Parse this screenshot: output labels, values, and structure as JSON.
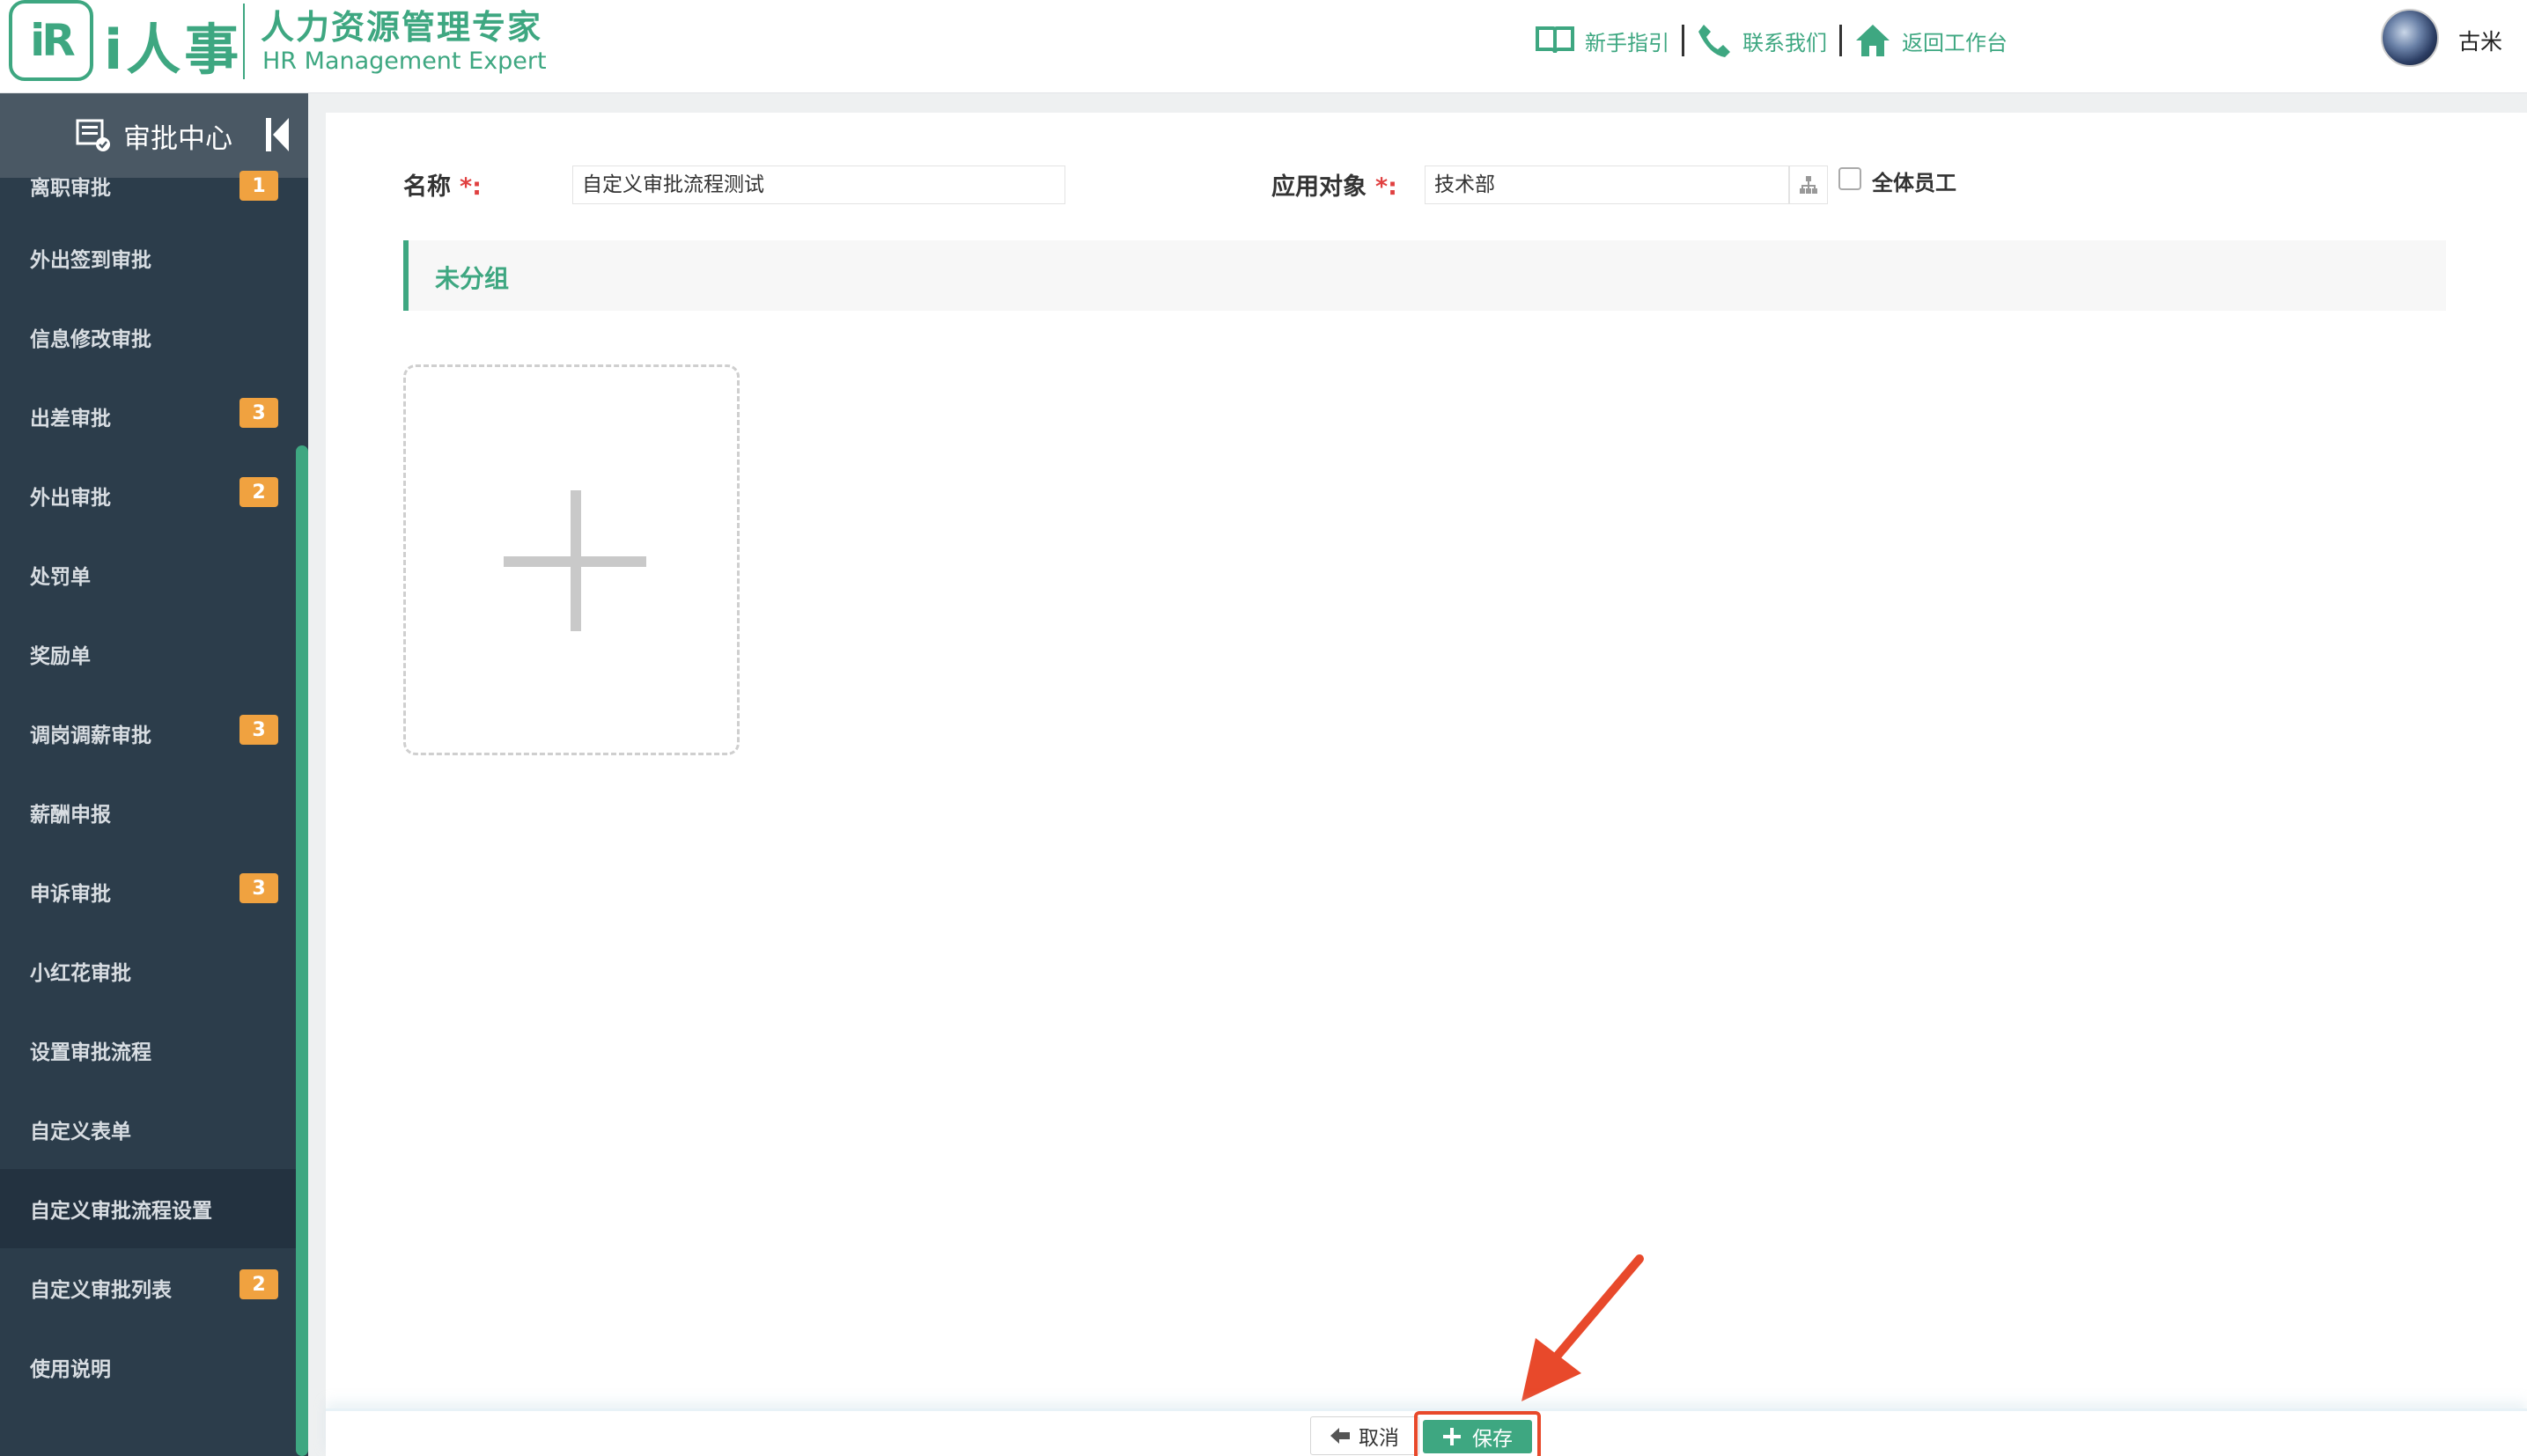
{
  "header": {
    "logo_mark": "iR",
    "logo_name": "i人事",
    "logo_cn": "人力资源管理专家",
    "logo_en": "HR Management Expert",
    "links": [
      {
        "label": "新手指引",
        "icon": "book-icon"
      },
      {
        "label": "联系我们",
        "icon": "phone-icon"
      },
      {
        "label": "返回工作台",
        "icon": "home-icon"
      }
    ],
    "username": "古米"
  },
  "sidebar": {
    "title": "审批中心",
    "items": [
      {
        "label": "离职审批",
        "badge": "1"
      },
      {
        "label": "外出签到审批",
        "badge": ""
      },
      {
        "label": "信息修改审批",
        "badge": ""
      },
      {
        "label": "出差审批",
        "badge": "3"
      },
      {
        "label": "外出审批",
        "badge": "2"
      },
      {
        "label": "处罚单",
        "badge": ""
      },
      {
        "label": "奖励单",
        "badge": ""
      },
      {
        "label": "调岗调薪审批",
        "badge": "3"
      },
      {
        "label": "薪酬申报",
        "badge": ""
      },
      {
        "label": "申诉审批",
        "badge": "3"
      },
      {
        "label": "小红花审批",
        "badge": ""
      },
      {
        "label": "设置审批流程",
        "badge": ""
      },
      {
        "label": "自定义表单",
        "badge": ""
      },
      {
        "label": "自定义审批流程设置",
        "badge": "",
        "active": true
      },
      {
        "label": "自定义审批列表",
        "badge": "2"
      },
      {
        "label": "使用说明",
        "badge": ""
      }
    ]
  },
  "form": {
    "name_label": "名称",
    "name_value": "自定义审批流程测试",
    "target_label": "应用对象",
    "target_value": "技术部",
    "required_mark": "*:",
    "all_staff_label": "全体员工",
    "all_staff_checked": false
  },
  "group": {
    "title": "未分组"
  },
  "footer": {
    "cancel_label": "取消",
    "save_label": "保存"
  },
  "colors": {
    "accent": "#3ea781",
    "sidebar_bg": "#2c3d4b",
    "badge": "#f0a240",
    "highlight": "#e8492b"
  }
}
